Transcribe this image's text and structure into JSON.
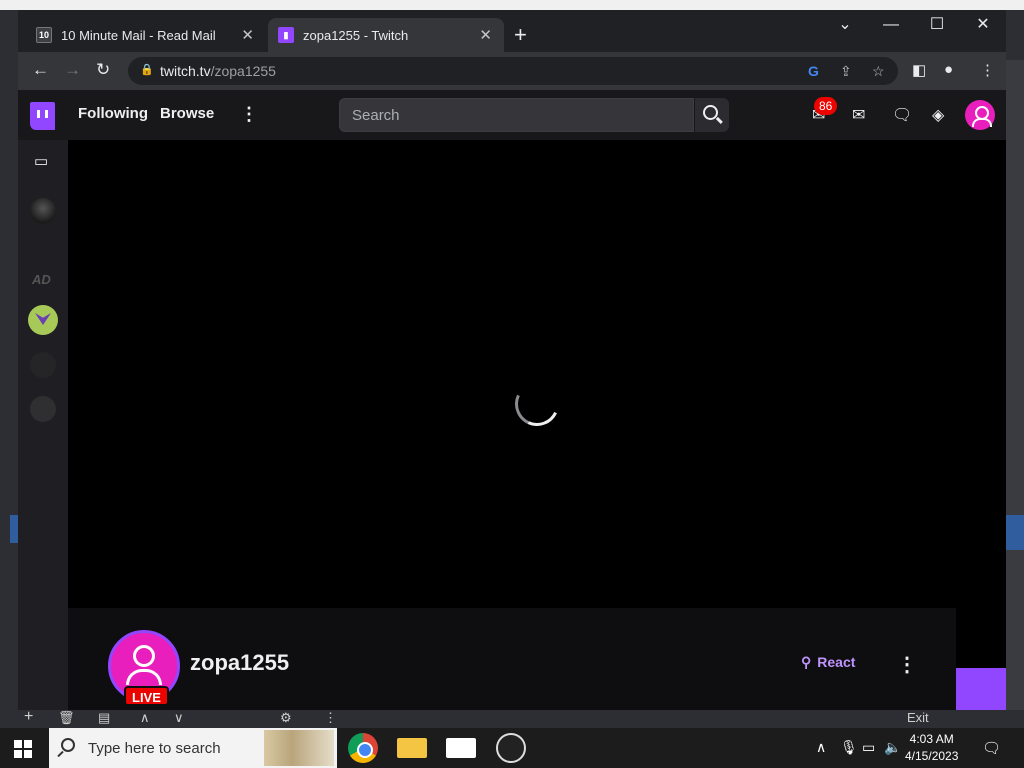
{
  "browser": {
    "tabs": [
      {
        "label": "10 Minute Mail - Read Mail",
        "favicon": "10"
      },
      {
        "label": "zopa1255 - Twitch"
      }
    ],
    "address": {
      "host": "twitch.tv",
      "path": "/zopa1255"
    }
  },
  "twitch": {
    "nav": {
      "following": "Following",
      "browse": "Browse"
    },
    "search_placeholder": "Search",
    "notification_count": "86",
    "channel": {
      "name": "zopa1255",
      "live_label": "LIVE",
      "react_label": "React"
    }
  },
  "obs": {
    "exit_label": "Exit"
  },
  "taskbar": {
    "search_placeholder": "Type here to search",
    "time": "4:03 AM",
    "date": "4/15/2023"
  },
  "colors": {
    "twitch_purple": "#9146ff",
    "live_red": "#eb0400",
    "avatar_pink": "#e91fbd"
  }
}
